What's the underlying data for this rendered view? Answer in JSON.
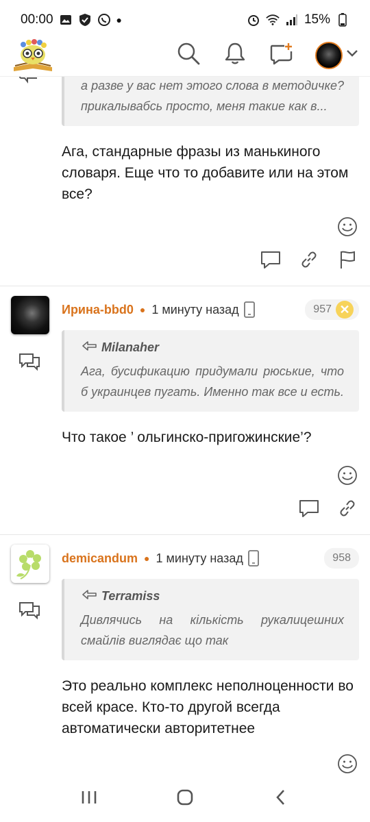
{
  "status": {
    "time": "00:00",
    "battery": "15%"
  },
  "header": {
    "logo": "owl-logo",
    "icons": [
      "search-icon",
      "bell-icon",
      "new-post-icon",
      "avatar",
      "chevron-down-icon"
    ]
  },
  "comments": [
    {
      "quote_text": "а разве у вас нет этого слова в методичке? прикалывабсь просто, меня такие как в...",
      "text": "Ага, стандарные фразы из манькиного словаря. Еще что то добавите или на этом все?"
    },
    {
      "author": "Ирина-bbd0",
      "time": "1 минуту назад",
      "number": "957",
      "quote_author": "Milanaher",
      "quote_text": "Ага, бусификацию придумали рюськие, что б украинцев пугать. Именно так все и есть.",
      "text": "Что такое ’ ольгинско-пригожинские’?"
    },
    {
      "author": "demicandum",
      "time": "1 минуту назад",
      "number": "958",
      "quote_author": "Terramiss",
      "quote_text": "Дивлячись на кількість рукалицешних смайлів виглядає що так",
      "text": "Это реально комплекс неполноценности во всей красе. Кто-то другой всегда автоматически авторитетнее"
    }
  ],
  "colors": {
    "author": "#d9731c",
    "badge_x": "#f7d35a"
  }
}
